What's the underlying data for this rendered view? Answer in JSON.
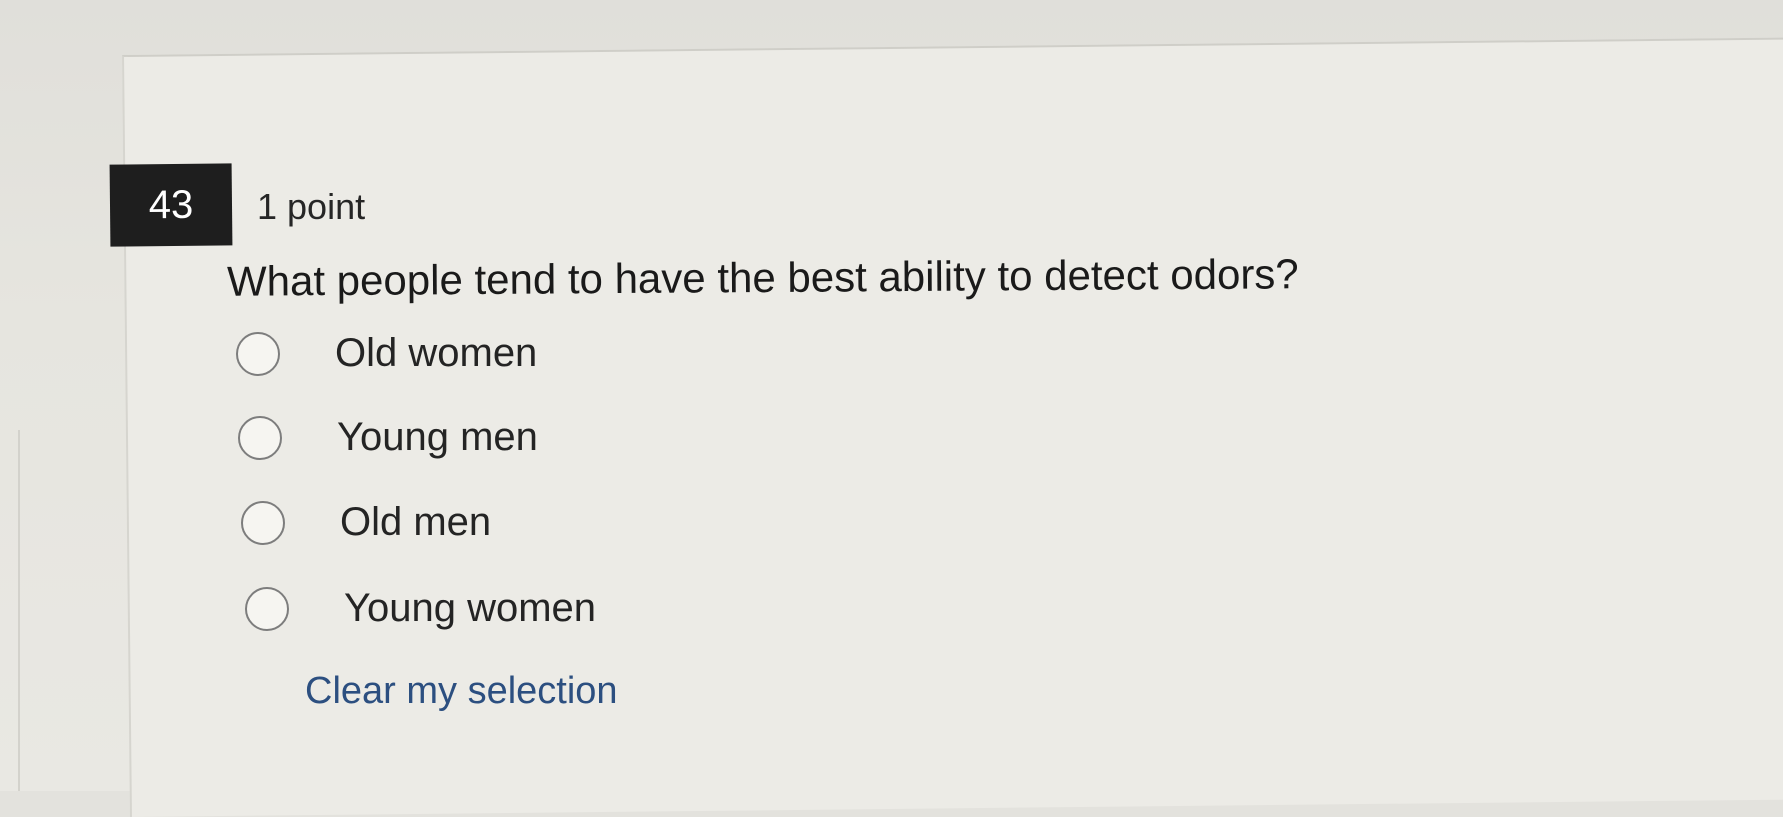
{
  "question": {
    "number": "43",
    "points": "1 point",
    "text": "What people tend to have the best ability to detect odors?"
  },
  "options": [
    {
      "label": "Old women",
      "selected": false
    },
    {
      "label": "Young men",
      "selected": false
    },
    {
      "label": "Old men",
      "selected": false
    },
    {
      "label": "Young women",
      "selected": false
    }
  ],
  "actions": {
    "clear_label": "Clear my selection"
  },
  "colors": {
    "page_background": "#e3e2dd",
    "number_badge_background": "#1e1e1e",
    "number_badge_text": "#ffffff",
    "link": "#2c4f80",
    "radio_border": "#7d7d7d"
  }
}
